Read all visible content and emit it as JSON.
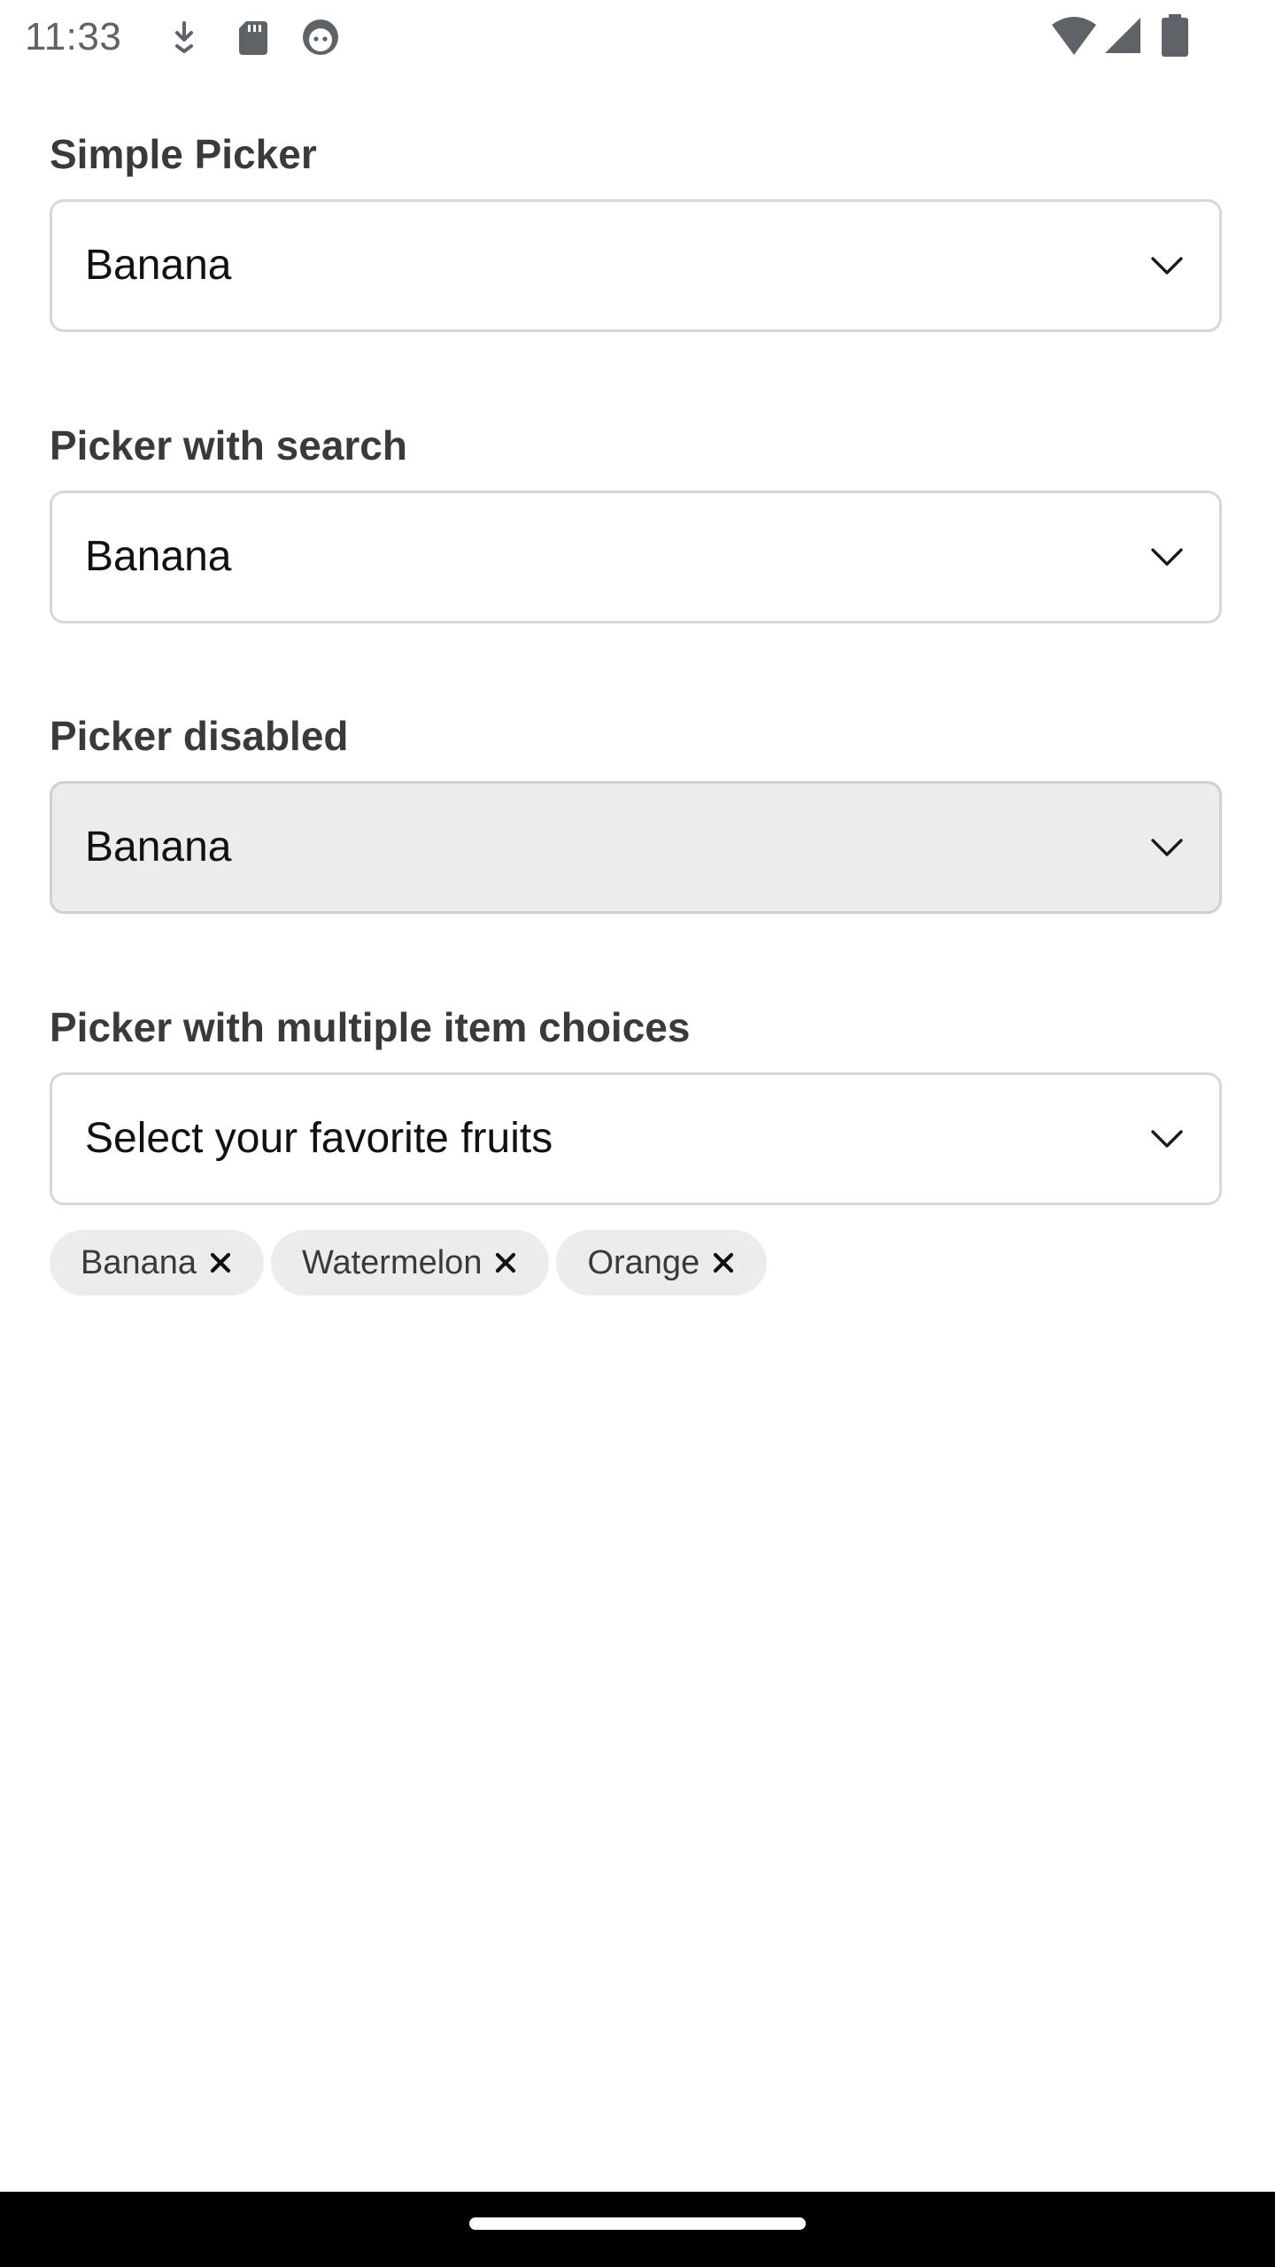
{
  "status_bar": {
    "time": "11:33",
    "icons_left": [
      "download-icon",
      "sd-card-icon",
      "face-icon"
    ],
    "icons_right": [
      "wifi-icon",
      "signal-icon",
      "battery-icon"
    ]
  },
  "sections": [
    {
      "label": "Simple Picker",
      "value": "Banana",
      "disabled": false
    },
    {
      "label": "Picker with search",
      "value": "Banana",
      "disabled": false
    },
    {
      "label": "Picker disabled",
      "value": "Banana",
      "disabled": true
    },
    {
      "label": "Picker with multiple item choices",
      "placeholder": "Select your favorite fruits",
      "disabled": false,
      "chips": [
        {
          "label": "Banana"
        },
        {
          "label": "Watermelon"
        },
        {
          "label": "Orange"
        }
      ]
    }
  ],
  "colors": {
    "border": "#d7d7d7",
    "disabled_background": "#ececec",
    "chip_background": "#ececec",
    "label_text": "#3a3a3a",
    "nav_bar": "#000000"
  }
}
